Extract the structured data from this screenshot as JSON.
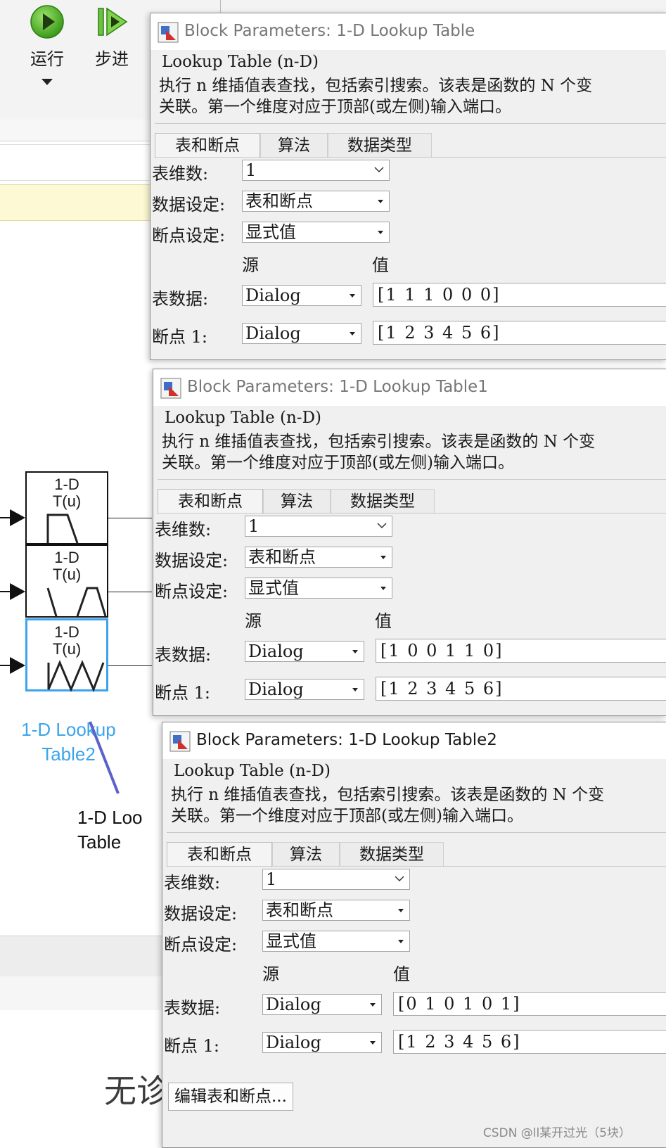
{
  "toolstrip": {
    "run_label": "运行",
    "step_label": "步进"
  },
  "canvas": {
    "blocks": [
      {
        "line1": "1-D",
        "line2": "T(u)"
      },
      {
        "line1": "1-D",
        "line2": "T(u)"
      },
      {
        "line1": "1-D",
        "line2": "T(u)"
      }
    ],
    "selected_block_name_line1": "1-D Lookup",
    "selected_block_name_line2": "Table2",
    "other_block_name_line1": "1-D Loo",
    "other_block_name_line2": "Table",
    "status_partial": "无诊"
  },
  "dialogs": [
    {
      "title": "Block Parameters: 1-D Lookup Table",
      "group_title": "Lookup Table (n-D)",
      "desc_line1": "执行 n 维插值表查找，包括索引搜索。该表是函数的 N 个变",
      "desc_line2": "关联。第一个维度对应于顶部(或左侧)输入端口。",
      "tabs": [
        "表和断点",
        "算法",
        "数据类型"
      ],
      "table_dims_label": "表维数:",
      "table_dims_value": "1",
      "data_spec_label": "数据设定:",
      "data_spec_value": "表和断点",
      "bp_spec_label": "断点设定:",
      "bp_spec_value": "显式值",
      "col_source": "源",
      "col_value": "值",
      "table_data_label": "表数据:",
      "table_data_source": "Dialog",
      "table_data_value": "[1 1 1 0 0 0]",
      "breakpoints_label": "断点 1:",
      "breakpoints_source": "Dialog",
      "breakpoints_value": "[1 2 3 4 5 6]"
    },
    {
      "title": "Block Parameters: 1-D Lookup Table1",
      "group_title": "Lookup Table (n-D)",
      "desc_line1": "执行 n 维插值表查找，包括索引搜索。该表是函数的 N 个变",
      "desc_line2": "关联。第一个维度对应于顶部(或左侧)输入端口。",
      "tabs": [
        "表和断点",
        "算法",
        "数据类型"
      ],
      "table_dims_label": "表维数:",
      "table_dims_value": "1",
      "data_spec_label": "数据设定:",
      "data_spec_value": "表和断点",
      "bp_spec_label": "断点设定:",
      "bp_spec_value": "显式值",
      "col_source": "源",
      "col_value": "值",
      "table_data_label": "表数据:",
      "table_data_source": "Dialog",
      "table_data_value": "[1 0 0 1 1 0]",
      "breakpoints_label": "断点 1:",
      "breakpoints_source": "Dialog",
      "breakpoints_value": "[1 2 3 4 5 6]"
    },
    {
      "title": "Block Parameters: 1-D Lookup Table2",
      "group_title": "Lookup Table (n-D)",
      "desc_line1": "执行 n 维插值表查找，包括索引搜索。该表是函数的 N 个变",
      "desc_line2": "关联。第一个维度对应于顶部(或左侧)输入端口。",
      "tabs": [
        "表和断点",
        "算法",
        "数据类型"
      ],
      "table_dims_label": "表维数:",
      "table_dims_value": "1",
      "data_spec_label": "数据设定:",
      "data_spec_value": "表和断点",
      "bp_spec_label": "断点设定:",
      "bp_spec_value": "显式值",
      "col_source": "源",
      "col_value": "值",
      "table_data_label": "表数据:",
      "table_data_source": "Dialog",
      "table_data_value": "[0 1 0 1 0 1]",
      "breakpoints_label": "断点 1:",
      "breakpoints_source": "Dialog",
      "breakpoints_value": "[1 2 3 4 5 6]",
      "edit_button": "编辑表和断点..."
    }
  ],
  "watermark": "CSDN @ll某开过光（5块）"
}
